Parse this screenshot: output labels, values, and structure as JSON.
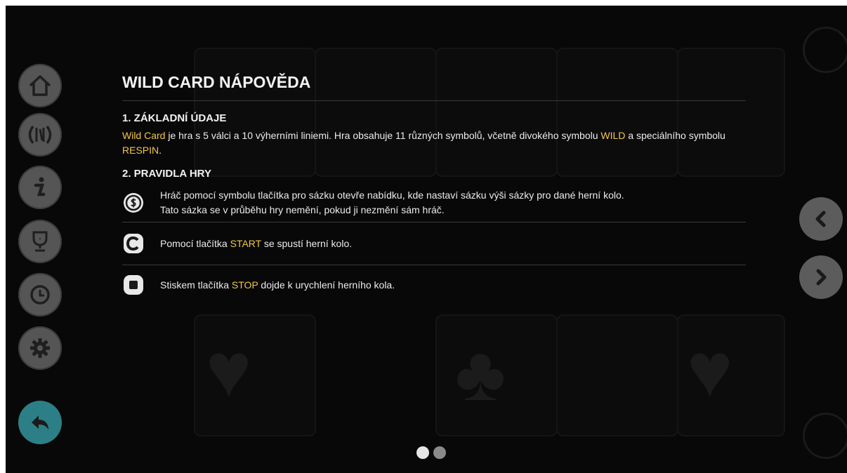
{
  "help": {
    "title": "WILD CARD NÁPOVĚDA",
    "section1": {
      "heading": "1. ZÁKLADNÍ ÚDAJE",
      "game_name": "Wild Card",
      "text_a": " je hra s 5 válci a 10 výherními liniemi. Hra obsahuje 11 různých symbolů, včetně divokého symbolu ",
      "wild": "WILD",
      "text_b": " a speciálního symbolu ",
      "respin": "RESPIN",
      "text_c": "."
    },
    "section2": {
      "heading": "2. PRAVIDLA HRY",
      "rules": [
        {
          "icon": "coin-bet-icon",
          "line1": "Hráč pomocí symbolu tlačítka pro sázku otevře nabídku, kde nastaví sázku výši sázky pro dané herní kolo.",
          "line2": "Tato sázka se v průběhu hry nemění, pokud ji nezmění sám hráč."
        },
        {
          "icon": "start-icon",
          "prefix": "Pomocí tlačítka ",
          "keyword": "START",
          "suffix": " se spustí herní kolo."
        },
        {
          "icon": "stop-icon",
          "prefix": "Stiskem tlačítka ",
          "keyword": "STOP",
          "suffix": " dojde k urychlení herního kola."
        }
      ]
    }
  },
  "left_menu": [
    {
      "name": "home-button",
      "icon": "home-icon"
    },
    {
      "name": "paytable-button",
      "icon": "paytable-icon"
    },
    {
      "name": "info-button",
      "icon": "info-icon"
    },
    {
      "name": "trophy-button",
      "icon": "trophy-icon"
    },
    {
      "name": "history-button",
      "icon": "clock-icon"
    },
    {
      "name": "settings-button",
      "icon": "gear-icon"
    },
    {
      "name": "back-button",
      "icon": "back-arrow-icon"
    }
  ],
  "pager": {
    "total_pages": 2,
    "current_page": 1
  },
  "colors": {
    "highlight": "#f1c74a",
    "back_button": "#2c7f86",
    "menu_button": "#555555",
    "text": "#f2f2f2",
    "background": "#080808"
  }
}
